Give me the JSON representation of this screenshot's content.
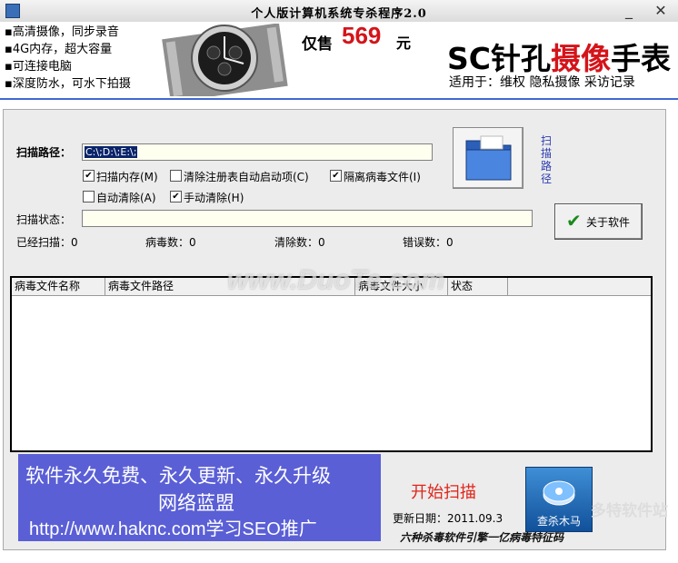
{
  "window": {
    "title": "个人版计算机系统专杀程序2.0",
    "minimize": "_",
    "close": "✕"
  },
  "banner": {
    "features": [
      "高清摄像，同步录音",
      "4G内存，超大容量",
      "可连接电脑",
      "深度防水，可水下拍摄"
    ],
    "price_prefix": "仅售",
    "price": "569",
    "price_unit": "元",
    "slogan_a": "SC针孔",
    "slogan_b": "摄像",
    "slogan_c": "手表",
    "usage": "适用于：维权    隐私摄像    采访记录"
  },
  "scan": {
    "path_label": "扫描路径：",
    "path_value": "C:\\;D:\\;E:\\;",
    "scan_path_button": "扫描路径",
    "options": [
      {
        "label": "扫描内存(M)",
        "checked": true
      },
      {
        "label": "清除注册表自动启动项(C)",
        "checked": false
      },
      {
        "label": "隔离病毒文件(I)",
        "checked": true
      },
      {
        "label": "自动清除(A)",
        "checked": false
      },
      {
        "label": "手动清除(H)",
        "checked": true
      }
    ],
    "status_label": "扫描状态：",
    "status_value": "",
    "about_button": "关于软件",
    "stats": {
      "scanned": "已经扫描：0",
      "virus": "病毒数：0",
      "cleared": "清除数：0",
      "errors": "错误数：0"
    }
  },
  "list": {
    "columns": [
      "病毒文件名称",
      "病毒文件路径",
      "病毒文件大小",
      "状态"
    ],
    "rows": []
  },
  "bottom": {
    "ad_line1": "软件永久免费、永久更新、永久升级",
    "ad_line2": "网络蓝盟",
    "ad_line3": "http://www.haknc.com学习SEO推广",
    "start_scan": "开始扫描",
    "update_date": "更新日期：2011.09.3",
    "engine_text": "六种杀毒软件引擎一亿病毒特征码",
    "killer_button": "查杀木马"
  },
  "watermarks": {
    "center": "www.DuoTe.com",
    "corner": "多特软件站"
  }
}
